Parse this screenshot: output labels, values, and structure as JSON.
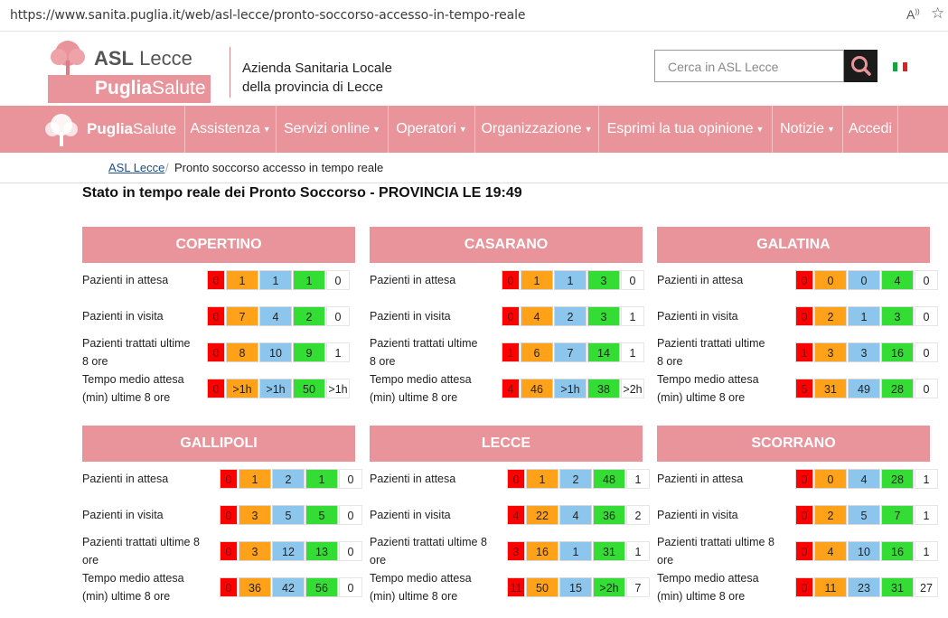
{
  "browser": {
    "url": "https://www.sanita.puglia.it/web/asl-lecce/pronto-soccorso-accesso-in-tempo-reale"
  },
  "header": {
    "logo_asl": "ASL",
    "logo_lecce": "Lecce",
    "logo_puglia": "Puglia",
    "logo_salute": "Salute",
    "org_line1": "Azienda Sanitaria Locale",
    "org_line2": "della provincia di Lecce",
    "search_placeholder": "Cerca in ASL Lecce"
  },
  "nav": {
    "brand_puglia": "Puglia",
    "brand_salute": "Salute",
    "items": [
      "Assistenza",
      "Servizi online",
      "Operatori",
      "Organizzazione",
      "Esprimi la tua opinione",
      "Notizie",
      "Accedi"
    ]
  },
  "breadcrumb": {
    "home": "ASL Lecce",
    "separator": "/",
    "current": "Pronto soccorso accesso in tempo reale"
  },
  "page_title": "Stato in tempo reale dei Pronto Soccorso - PROVINCIA LE 19:49",
  "row_labels": {
    "attesa": "Pazienti in attesa",
    "visita": "Pazienti in visita",
    "trattati_1": "Pazienti trattati ultime",
    "trattati_2": "8 ore",
    "trattati_b1": "Pazienti trattati ultime 8",
    "trattati_b2": "ore",
    "tempo_1": "Tempo medio attesa",
    "tempo_2": "(min) ultime 8 ore"
  },
  "colors": {
    "accent": "#e8949a",
    "red": "#ff0000",
    "orange": "#ffa21a",
    "blue": "#8dc6ed",
    "green": "#33dd33"
  },
  "hospitals": [
    {
      "name": "COPERTINO",
      "attesa": [
        "0",
        "1",
        "1",
        "1",
        "0"
      ],
      "visita": [
        "0",
        "7",
        "4",
        "2",
        "0"
      ],
      "trattati": [
        "0",
        "8",
        "10",
        "9",
        "1"
      ],
      "tempo": [
        "0",
        ">1h",
        ">1h",
        "50",
        ">1h"
      ]
    },
    {
      "name": "CASARANO",
      "attesa": [
        "0",
        "1",
        "1",
        "3",
        "0"
      ],
      "visita": [
        "0",
        "4",
        "2",
        "3",
        "1"
      ],
      "trattati": [
        "1",
        "6",
        "7",
        "14",
        "1"
      ],
      "tempo": [
        "4",
        "46",
        ">1h",
        "38",
        ">2h"
      ]
    },
    {
      "name": "GALATINA",
      "attesa": [
        "0",
        "0",
        "0",
        "4",
        "0"
      ],
      "visita": [
        "0",
        "2",
        "1",
        "3",
        "0"
      ],
      "trattati": [
        "1",
        "3",
        "3",
        "16",
        "0"
      ],
      "tempo": [
        "5",
        "31",
        "49",
        "28",
        "0"
      ]
    },
    {
      "name": "GALLIPOLI",
      "attesa": [
        "0",
        "1",
        "2",
        "1",
        "0"
      ],
      "visita": [
        "0",
        "3",
        "5",
        "5",
        "0"
      ],
      "trattati": [
        "0",
        "3",
        "12",
        "13",
        "0"
      ],
      "tempo": [
        "0",
        "36",
        "42",
        "56",
        "0"
      ]
    },
    {
      "name": "LECCE",
      "attesa": [
        "0",
        "1",
        "2",
        "48",
        "1"
      ],
      "visita": [
        "4",
        "22",
        "4",
        "36",
        "2"
      ],
      "trattati": [
        "3",
        "16",
        "1",
        "31",
        "1"
      ],
      "tempo": [
        "11",
        "50",
        "15",
        ">2h",
        "7"
      ]
    },
    {
      "name": "SCORRANO",
      "attesa": [
        "0",
        "0",
        "4",
        "28",
        "1"
      ],
      "visita": [
        "0",
        "2",
        "5",
        "7",
        "1"
      ],
      "trattati": [
        "0",
        "4",
        "10",
        "16",
        "1"
      ],
      "tempo": [
        "0",
        "11",
        "23",
        "31",
        "27"
      ]
    }
  ]
}
